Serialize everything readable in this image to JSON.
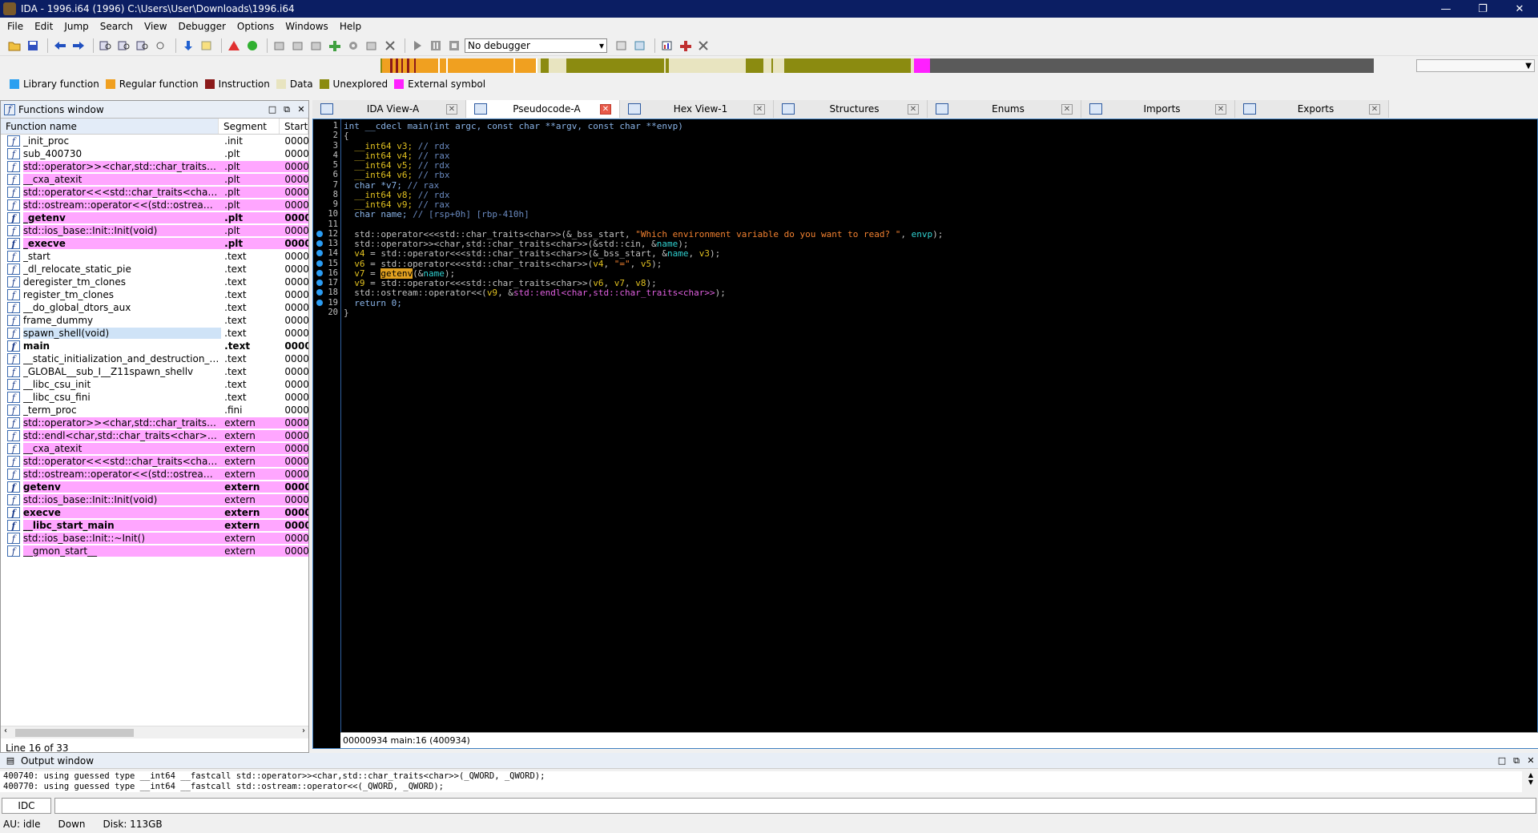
{
  "window": {
    "title": "IDA - 1996.i64 (1996) C:\\Users\\User\\Downloads\\1996.i64",
    "min": "—",
    "max": "❐",
    "close": "✕"
  },
  "menu": [
    "File",
    "Edit",
    "Jump",
    "Search",
    "View",
    "Debugger",
    "Options",
    "Windows",
    "Help"
  ],
  "toolbar": {
    "debugger_select": "No debugger"
  },
  "legend": [
    {
      "label": "Library function",
      "color": "#2aa0f0"
    },
    {
      "label": "Regular function",
      "color": "#f0a020"
    },
    {
      "label": "Instruction",
      "color": "#8b1a1a"
    },
    {
      "label": "Data",
      "color": "#e8e4c0"
    },
    {
      "label": "Unexplored",
      "color": "#8b8b10"
    },
    {
      "label": "External symbol",
      "color": "#ff20ff"
    }
  ],
  "functions_window": {
    "title": "Functions window",
    "columns": [
      "Function name",
      "Segment",
      "Start"
    ],
    "line_info": "Line 16 of 33",
    "rows": [
      {
        "name": "_init_proc",
        "seg": ".init",
        "start": "0000",
        "pink": false,
        "bold": false
      },
      {
        "name": "sub_400730",
        "seg": ".plt",
        "start": "0000",
        "pink": false,
        "bold": false
      },
      {
        "name": "std::operator>><char,std::char_traits<ch…",
        "seg": ".plt",
        "start": "0000",
        "pink": true,
        "bold": false
      },
      {
        "name": "__cxa_atexit",
        "seg": ".plt",
        "start": "0000",
        "pink": true,
        "bold": false
      },
      {
        "name": "std::operator<<<std::char_traits<char>>…",
        "seg": ".plt",
        "start": "0000",
        "pink": true,
        "bold": false
      },
      {
        "name": "std::ostream::operator<<(std::ostream &…",
        "seg": ".plt",
        "start": "0000",
        "pink": true,
        "bold": false
      },
      {
        "name": "_getenv",
        "seg": ".plt",
        "start": "0000",
        "pink": true,
        "bold": true
      },
      {
        "name": "std::ios_base::Init::Init(void)",
        "seg": ".plt",
        "start": "0000",
        "pink": true,
        "bold": false
      },
      {
        "name": "_execve",
        "seg": ".plt",
        "start": "0000",
        "pink": true,
        "bold": true
      },
      {
        "name": "_start",
        "seg": ".text",
        "start": "0000",
        "pink": false,
        "bold": false
      },
      {
        "name": "_dl_relocate_static_pie",
        "seg": ".text",
        "start": "0000",
        "pink": false,
        "bold": false
      },
      {
        "name": "deregister_tm_clones",
        "seg": ".text",
        "start": "0000",
        "pink": false,
        "bold": false
      },
      {
        "name": "register_tm_clones",
        "seg": ".text",
        "start": "0000",
        "pink": false,
        "bold": false
      },
      {
        "name": "__do_global_dtors_aux",
        "seg": ".text",
        "start": "0000",
        "pink": false,
        "bold": false
      },
      {
        "name": "frame_dummy",
        "seg": ".text",
        "start": "0000",
        "pink": false,
        "bold": false
      },
      {
        "name": "spawn_shell(void)",
        "seg": ".text",
        "start": "0000",
        "pink": false,
        "bold": false,
        "sel": true
      },
      {
        "name": "main",
        "seg": ".text",
        "start": "0000",
        "pink": false,
        "bold": true
      },
      {
        "name": "__static_initialization_and_destruction_0(i…",
        "seg": ".text",
        "start": "0000",
        "pink": false,
        "bold": false
      },
      {
        "name": "_GLOBAL__sub_I__Z11spawn_shellv",
        "seg": ".text",
        "start": "0000",
        "pink": false,
        "bold": false
      },
      {
        "name": "__libc_csu_init",
        "seg": ".text",
        "start": "0000",
        "pink": false,
        "bold": false
      },
      {
        "name": "__libc_csu_fini",
        "seg": ".text",
        "start": "0000",
        "pink": false,
        "bold": false
      },
      {
        "name": "_term_proc",
        "seg": ".fini",
        "start": "0000",
        "pink": false,
        "bold": false
      },
      {
        "name": "std::operator>><char,std::char_traits<ch…",
        "seg": "extern",
        "start": "0000",
        "pink": true,
        "bold": false
      },
      {
        "name": "std::endl<char,std::char_traits<char>>(s…",
        "seg": "extern",
        "start": "0000",
        "pink": true,
        "bold": false
      },
      {
        "name": "__cxa_atexit",
        "seg": "extern",
        "start": "0000",
        "pink": true,
        "bold": false
      },
      {
        "name": "std::operator<<<std::char_traits<char>>…",
        "seg": "extern",
        "start": "0000",
        "pink": true,
        "bold": false
      },
      {
        "name": "std::ostream::operator<<(std::ostream &…",
        "seg": "extern",
        "start": "0000",
        "pink": true,
        "bold": false
      },
      {
        "name": "getenv",
        "seg": "extern",
        "start": "0000",
        "pink": true,
        "bold": true
      },
      {
        "name": "std::ios_base::Init::Init(void)",
        "seg": "extern",
        "start": "0000",
        "pink": true,
        "bold": false
      },
      {
        "name": "execve",
        "seg": "extern",
        "start": "0000",
        "pink": true,
        "bold": true
      },
      {
        "name": "__libc_start_main",
        "seg": "extern",
        "start": "0000",
        "pink": true,
        "bold": true
      },
      {
        "name": "std::ios_base::Init::~Init()",
        "seg": "extern",
        "start": "0000",
        "pink": true,
        "bold": false
      },
      {
        "name": "__gmon_start__",
        "seg": "extern",
        "start": "0000",
        "pink": true,
        "bold": false
      }
    ]
  },
  "tabs": [
    {
      "label": "IDA View-A",
      "active": false
    },
    {
      "label": "Pseudocode-A",
      "active": true
    },
    {
      "label": "Hex View-1",
      "active": false
    },
    {
      "label": "Structures",
      "active": false
    },
    {
      "label": "Enums",
      "active": false
    },
    {
      "label": "Imports",
      "active": false
    },
    {
      "label": "Exports",
      "active": false
    }
  ],
  "pseudocode": {
    "breakpoint_lines": [
      12,
      13,
      14,
      15,
      16,
      17,
      18,
      19
    ],
    "lines": [
      [
        [
          "kw",
          "int __cdecl main(int argc, const char **argv, const char **envp)"
        ]
      ],
      [
        [
          "",
          "{"
        ]
      ],
      [
        [
          "ty",
          "  __int64 v3; "
        ],
        [
          "cm",
          "// rdx"
        ]
      ],
      [
        [
          "ty",
          "  __int64 v4; "
        ],
        [
          "cm",
          "// rax"
        ]
      ],
      [
        [
          "ty",
          "  __int64 v5; "
        ],
        [
          "cm",
          "// rdx"
        ]
      ],
      [
        [
          "ty",
          "  __int64 v6; "
        ],
        [
          "cm",
          "// rbx"
        ]
      ],
      [
        [
          "kw",
          "  char *v7; "
        ],
        [
          "cm",
          "// rax"
        ]
      ],
      [
        [
          "ty",
          "  __int64 v8; "
        ],
        [
          "cm",
          "// rdx"
        ]
      ],
      [
        [
          "ty",
          "  __int64 v9; "
        ],
        [
          "cm",
          "// rax"
        ]
      ],
      [
        [
          "kw",
          "  char name; "
        ],
        [
          "cm",
          "// [rsp+0h] [rbp-410h]"
        ]
      ],
      [
        [
          "",
          ""
        ]
      ],
      [
        [
          "",
          "  std::operator<<<std::char_traits<char>>(&_bss_start, "
        ],
        [
          "str",
          "\"Which environment variable do you want to read? \""
        ],
        [
          "",
          ", "
        ],
        [
          "nm",
          "envp"
        ],
        [
          "",
          ");"
        ]
      ],
      [
        [
          "",
          "  std::operator>><char,std::char_traits<char>>(&std::cin, &"
        ],
        [
          "nm",
          "name"
        ],
        [
          "",
          ");"
        ]
      ],
      [
        [
          "ty",
          "  v4"
        ],
        [
          "",
          " = std::operator<<<std::char_traits<char>>(&_bss_start, &"
        ],
        [
          "nm",
          "name"
        ],
        [
          "",
          ", "
        ],
        [
          "ty",
          "v3"
        ],
        [
          "",
          ");"
        ]
      ],
      [
        [
          "ty",
          "  v6"
        ],
        [
          "",
          " = std::operator<<<std::char_traits<char>>("
        ],
        [
          "ty",
          "v4"
        ],
        [
          "",
          ", "
        ],
        [
          "str",
          "\"=\""
        ],
        [
          "",
          ", "
        ],
        [
          "ty",
          "v5"
        ],
        [
          "",
          ");"
        ]
      ],
      [
        [
          "ty",
          "  v7"
        ],
        [
          "",
          " = "
        ],
        [
          "hl",
          "getenv"
        ],
        [
          "",
          "(&"
        ],
        [
          "nm",
          "name"
        ],
        [
          "",
          ");"
        ]
      ],
      [
        [
          "ty",
          "  v9"
        ],
        [
          "",
          " = std::operator<<<std::char_traits<char>>("
        ],
        [
          "ty",
          "v6"
        ],
        [
          "",
          ", "
        ],
        [
          "ty",
          "v7"
        ],
        [
          "",
          ", "
        ],
        [
          "ty",
          "v8"
        ],
        [
          "",
          ");"
        ]
      ],
      [
        [
          "",
          "  std::ostream::operator<<("
        ],
        [
          "ty",
          "v9"
        ],
        [
          "",
          ", &"
        ],
        [
          "id",
          "std::endl<char,std::char_traits<char>>"
        ],
        [
          "",
          ");"
        ]
      ],
      [
        [
          "kw",
          "  return 0;"
        ]
      ],
      [
        [
          "",
          "}"
        ]
      ]
    ],
    "status": "00000934 main:16 (400934)"
  },
  "output_window": {
    "title": "Output window",
    "lines": [
      "400740: using guessed type __int64 __fastcall std::operator>><char,std::char_traits<char>>(_QWORD, _QWORD);",
      "400770: using guessed type __int64 __fastcall std::ostream::operator<<(_QWORD, _QWORD);"
    ],
    "idc_label": "IDC",
    "status": {
      "au": "AU:  idle",
      "dir": "Down",
      "disk": "Disk: 113GB"
    }
  }
}
